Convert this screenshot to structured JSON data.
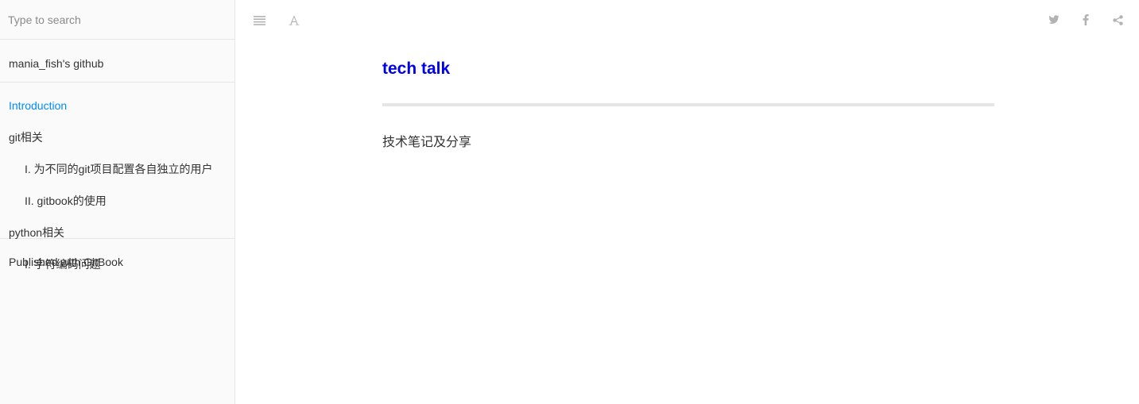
{
  "search": {
    "placeholder": "Type to search"
  },
  "sidebar": {
    "header_link": "mania_fish's github",
    "items": [
      {
        "label": "Introduction",
        "active": true,
        "level": 0
      },
      {
        "label": "git相关",
        "level": 0
      },
      {
        "label": "I. 为不同的git项目配置各自独立的用户",
        "level": 1
      },
      {
        "label": "II. gitbook的使用",
        "level": 1
      },
      {
        "label": "python相关",
        "level": 0
      },
      {
        "label": "I. 字符编码问题",
        "level": 1
      }
    ],
    "footer_link": "Published with GitBook"
  },
  "toolbar": {
    "left_icons": [
      "menu-icon",
      "font-settings-icon"
    ],
    "right_icons": [
      "twitter-icon",
      "facebook-icon",
      "share-icon"
    ]
  },
  "page": {
    "title": "tech talk",
    "body": "技术笔记及分享"
  },
  "colors": {
    "accent": "#008cff",
    "title": "#0000ee",
    "icon": "#b3b3b3",
    "sidebar_bg": "#fafafa",
    "border": "#e6e6e6"
  }
}
